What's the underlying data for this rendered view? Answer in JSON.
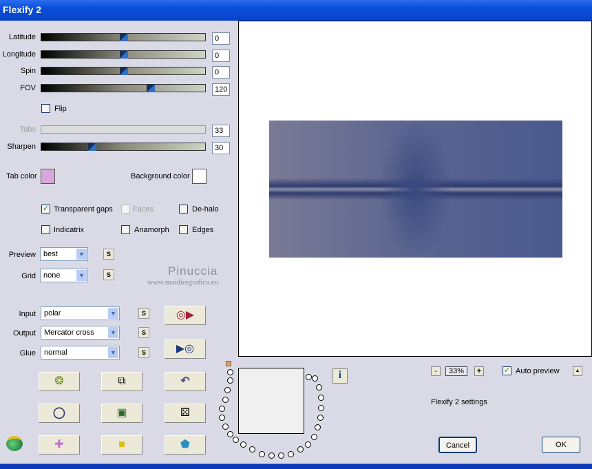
{
  "window": {
    "title": "Flexify 2"
  },
  "sliders": [
    {
      "label": "Latitude",
      "value": "0",
      "fraction": 0.5
    },
    {
      "label": "Longitude",
      "value": "0",
      "fraction": 0.5
    },
    {
      "label": "Spin",
      "value": "0",
      "fraction": 0.5
    },
    {
      "label": "FOV",
      "value": "120",
      "fraction": 0.67
    },
    {
      "label": "Tabs",
      "value": "33",
      "fraction": null
    },
    {
      "label": "Sharpen",
      "value": "30",
      "fraction": 0.3
    }
  ],
  "flip": {
    "label": "Flip",
    "checked": false
  },
  "tab_color": {
    "label": "Tab color",
    "color": "#d8a8d8"
  },
  "background_color": {
    "label": "Background color",
    "color": "#ffffff"
  },
  "options": {
    "transparent_gaps": "Transparent gaps",
    "faces": "Faces",
    "de_halo": "De-halo",
    "indicatrix": "Indicatrix",
    "anamorph": "Anamorph",
    "edges": "Edges",
    "check_mark": "✓"
  },
  "preview": {
    "label": "Preview",
    "value": "best"
  },
  "grid": {
    "label": "Grid",
    "value": "none"
  },
  "input": {
    "label": "Input",
    "value": "polar"
  },
  "output": {
    "label": "Output",
    "value": "Mercator cross"
  },
  "glue": {
    "label": "Glue",
    "value": "normal"
  },
  "s_label": "S",
  "watermark": {
    "name": "Pinuccia",
    "url": "www.maidiregrafica.eu"
  },
  "zoom": {
    "value": "33%",
    "minus": "-",
    "plus": "+"
  },
  "auto_preview": {
    "label": "Auto preview",
    "checked": true
  },
  "up_btn": "▲",
  "info": "i",
  "settings_label": "Flexify 2 settings",
  "cancel": "Cancel",
  "ok": "OK"
}
